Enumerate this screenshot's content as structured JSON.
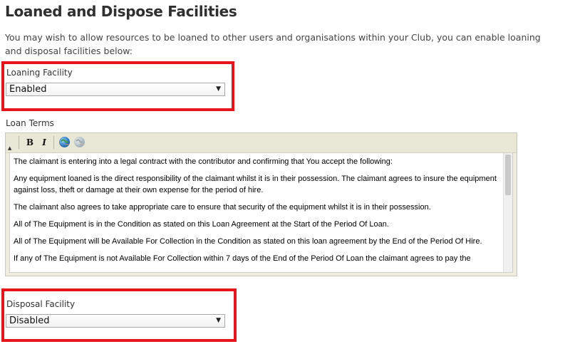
{
  "page": {
    "title": "Loaned and Dispose Facilities",
    "intro": "You may wish to allow resources to be loaned to other users and organisations within your Club, you can enable loaning and disposal facilities below:"
  },
  "loaning": {
    "label": "Loaning Facility",
    "value": "Enabled"
  },
  "loan_terms": {
    "label": "Loan Terms",
    "toolbar": {
      "bold": "B",
      "italic": "I",
      "icons": [
        "collapse-arrow-icon",
        "bold-icon",
        "italic-icon",
        "link-icon",
        "unlink-icon"
      ]
    },
    "paragraphs": [
      "The claimant is entering into a legal contract with the contributor and confirming that You accept the following:",
      "Any equipment loaned is the direct responsibility of the claimant whilst it is in their possession. The claimant agrees to insure the equipment against loss, theft or damage at their own expense for the period of hire.",
      "The claimant also agrees to take appropriate care to ensure that security of the equipment whilst it is in their possession.",
      "All of The Equipment is in the Condition as stated on this Loan Agreement at the Start of the Period Of Loan.",
      "All of The Equipment will be Available For Collection in the Condition as stated on this loan agreement by the End of the Period Of Hire.",
      "If any of The Equipment is not Available For Collection within 7 days of the End of the Period Of Loan the claimant agrees to pay the"
    ]
  },
  "disposal": {
    "label": "Disposal Facility",
    "value": "Disabled"
  },
  "colors": {
    "highlight": "#e8141b",
    "editor_toolbar": "#e9e8d6"
  }
}
